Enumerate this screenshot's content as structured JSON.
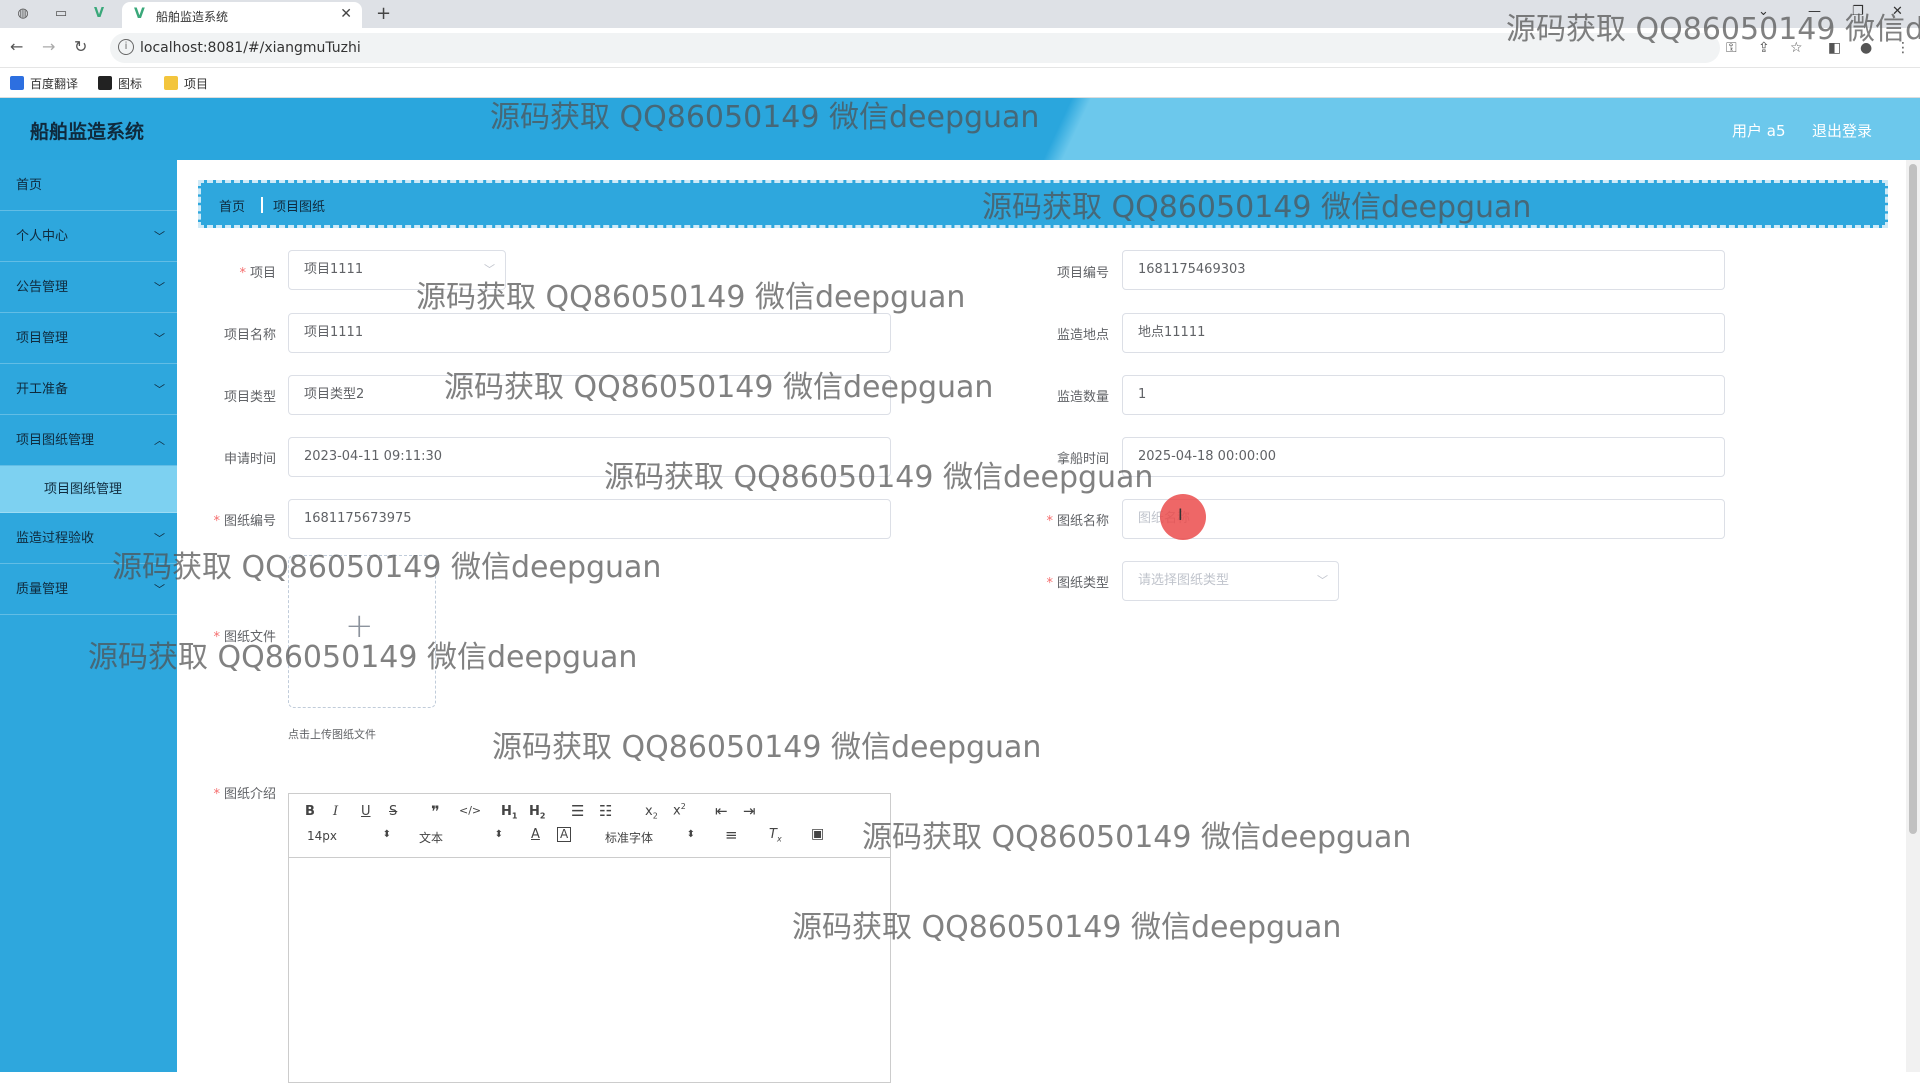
{
  "browser": {
    "tab_title": "船舶监造系统",
    "url": "localhost:8081/#/xiangmuTuzhi",
    "bookmarks": [
      "百度翻译",
      "图标",
      "项目"
    ]
  },
  "header": {
    "title": "船舶监造系统",
    "user": "用户 a5",
    "logout": "退出登录"
  },
  "sidebar": {
    "items": [
      {
        "label": "首页"
      },
      {
        "label": "个人中心"
      },
      {
        "label": "公告管理"
      },
      {
        "label": "项目管理"
      },
      {
        "label": "开工准备"
      },
      {
        "label": "项目图纸管理"
      },
      {
        "label": "项目图纸管理"
      },
      {
        "label": "监造过程验收"
      },
      {
        "label": "质量管理"
      }
    ]
  },
  "breadcrumb": [
    "首页",
    "项目图纸"
  ],
  "form": {
    "project_label": "项目",
    "project_value": "项目1111",
    "project_no_label": "项目编号",
    "project_no_value": "1681175469303",
    "project_name_label": "项目名称",
    "project_name_value": "项目1111",
    "location_label": "监造地点",
    "location_value": "地点11111",
    "type_label": "项目类型",
    "type_value": "项目类型2",
    "qty_label": "监造数量",
    "qty_value": "1",
    "apply_time_label": "申请时间",
    "apply_time_value": "2023-04-11 09:11:30",
    "ship_time_label": "拿船时间",
    "ship_time_value": "2025-04-18 00:00:00",
    "drawing_no_label": "图纸编号",
    "drawing_no_value": "1681175673975",
    "drawing_name_label": "图纸名称",
    "drawing_name_placeholder": "图纸名称",
    "drawing_type_label": "图纸类型",
    "drawing_type_placeholder": "请选择图纸类型",
    "drawing_file_label": "图纸文件",
    "upload_tip": "点击上传图纸文件",
    "drawing_intro_label": "图纸介绍"
  },
  "editor": {
    "font_size": "14px",
    "format": "文本",
    "font_family": "标准字体"
  },
  "watermark": "源码获取 QQ86050149 微信deepguan"
}
